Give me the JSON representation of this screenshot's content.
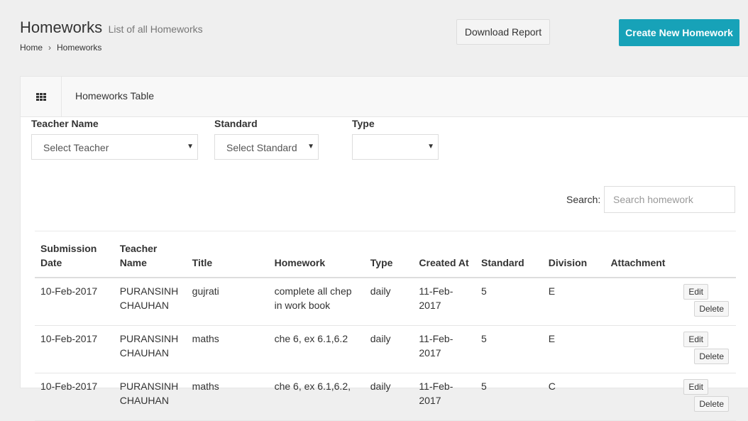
{
  "header": {
    "title": "Homeworks",
    "subtitle": "List of all Homeworks",
    "breadcrumb": {
      "home": "Home",
      "separator": "›",
      "current": "Homeworks"
    },
    "download_label": "Download Report",
    "create_label": "Create New Homework"
  },
  "colors": {
    "accent": "#17a2b8"
  },
  "card": {
    "icon": "grid-icon",
    "title": "Homeworks Table"
  },
  "filters": {
    "teacher": {
      "label": "Teacher Name",
      "value": "Select Teacher"
    },
    "standard": {
      "label": "Standard",
      "value": "Select Standard"
    },
    "type": {
      "label": "Type",
      "value": ""
    }
  },
  "search": {
    "label": "Search:",
    "placeholder": "Search homework"
  },
  "table": {
    "columns": [
      "Submission Date",
      "Teacher Name",
      "Title",
      "Homework",
      "Type",
      "Created At",
      "Standard",
      "Division",
      "Attachment",
      ""
    ],
    "rows": [
      {
        "submission": "10-Feb-2017",
        "teacher": "PURANSINH CHAUHAN",
        "title": "gujrati",
        "homework": "complete all chep in work book",
        "type": "daily",
        "created": "11-Feb-2017",
        "standard": "5",
        "division": "E",
        "attachment": "",
        "edit": "Edit",
        "delete": "Delete"
      },
      {
        "submission": "10-Feb-2017",
        "teacher": "PURANSINH CHAUHAN",
        "title": "maths",
        "homework": "che 6, ex 6.1,6.2",
        "type": "daily",
        "created": "11-Feb-2017",
        "standard": "5",
        "division": "E",
        "attachment": "",
        "edit": "Edit",
        "delete": "Delete"
      },
      {
        "submission": "10-Feb-2017",
        "teacher": "PURANSINH CHAUHAN",
        "title": "maths",
        "homework": "che 6, ex 6.1,6.2,",
        "type": "daily",
        "created": "11-Feb-2017",
        "standard": "5",
        "division": "C",
        "attachment": "",
        "edit": "Edit",
        "delete": "Delete"
      }
    ]
  }
}
